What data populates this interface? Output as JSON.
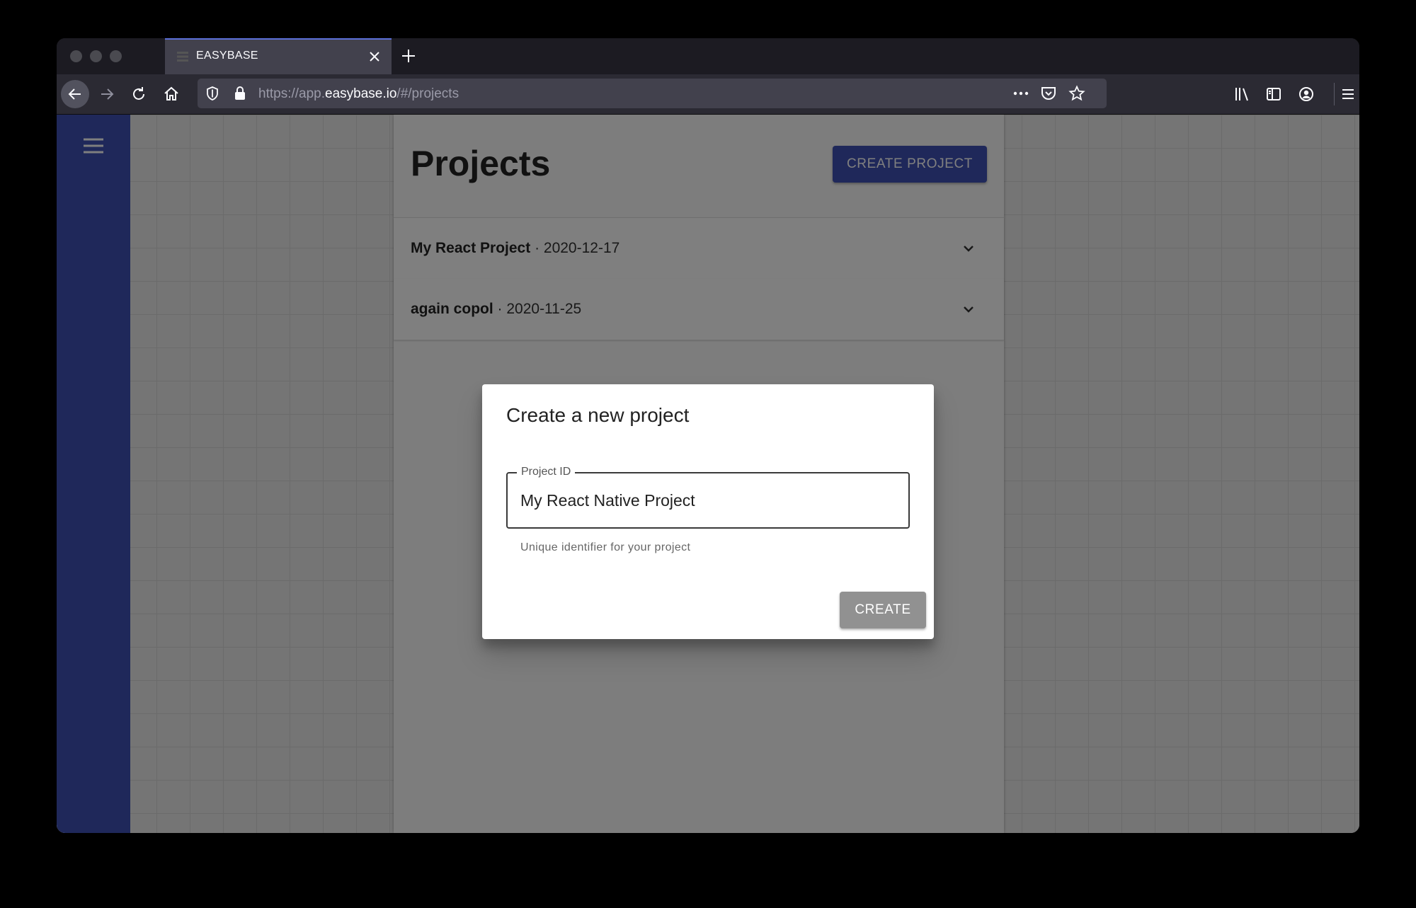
{
  "browser": {
    "tab": {
      "title": "EASYBASE"
    },
    "url": {
      "prefix": "https://app.",
      "host": "easybase.io",
      "path": "/#/projects"
    }
  },
  "main": {
    "title": "Projects",
    "create_project_label": "CREATE PROJECT",
    "projects": [
      {
        "name": "My React Project",
        "date": " · 2020-12-17"
      },
      {
        "name": "again copol",
        "date": " · 2020-11-25"
      }
    ]
  },
  "dialog": {
    "title": "Create a new project",
    "field_label": "Project ID",
    "field_value": "My React Native Project",
    "helper_text": "Unique identifier for your project",
    "create_label": "CREATE"
  },
  "colors": {
    "primary": "#3f51b5",
    "disabled_button": "#919191"
  }
}
